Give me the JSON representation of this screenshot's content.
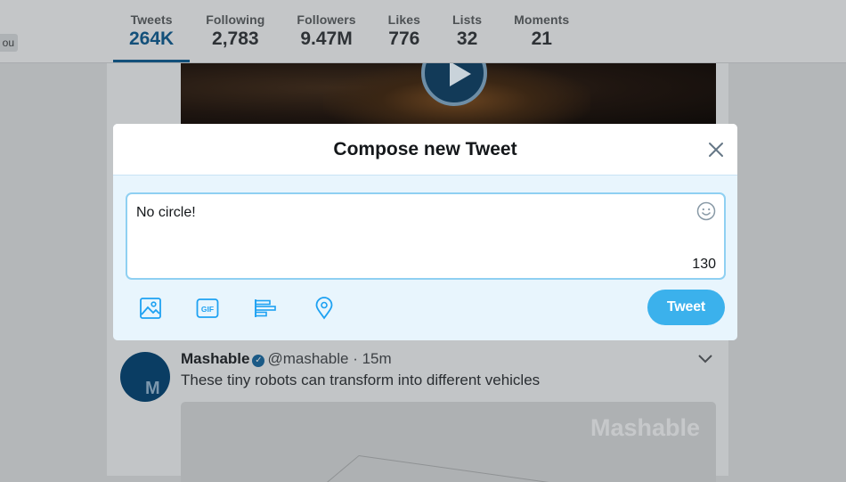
{
  "profile_nav": {
    "left_pill_text": "ou",
    "stats": [
      {
        "label": "Tweets",
        "value": "264K"
      },
      {
        "label": "Following",
        "value": "2,783"
      },
      {
        "label": "Followers",
        "value": "9.47M"
      },
      {
        "label": "Likes",
        "value": "776"
      },
      {
        "label": "Lists",
        "value": "32"
      },
      {
        "label": "Moments",
        "value": "21"
      }
    ]
  },
  "compose_modal": {
    "title": "Compose new Tweet",
    "text_value": "No circle!",
    "char_counter": "130",
    "tweet_button_label": "Tweet",
    "gif_label": "GIF",
    "toolbar_icons": [
      "image-icon",
      "gif-icon",
      "poll-icon",
      "location-icon"
    ]
  },
  "timeline_tweet": {
    "author_name": "Mashable",
    "handle": "@mashable",
    "separator": "·",
    "time": "15m",
    "text": "These tiny robots can transform into different vehicles",
    "avatar_letter": "M",
    "media_watermark": "Mashable"
  },
  "colors": {
    "accent": "#3bb1ec",
    "active_tab": "#13507a",
    "modal_bg": "#e8f5fd",
    "compose_border": "#8fd0f2"
  }
}
